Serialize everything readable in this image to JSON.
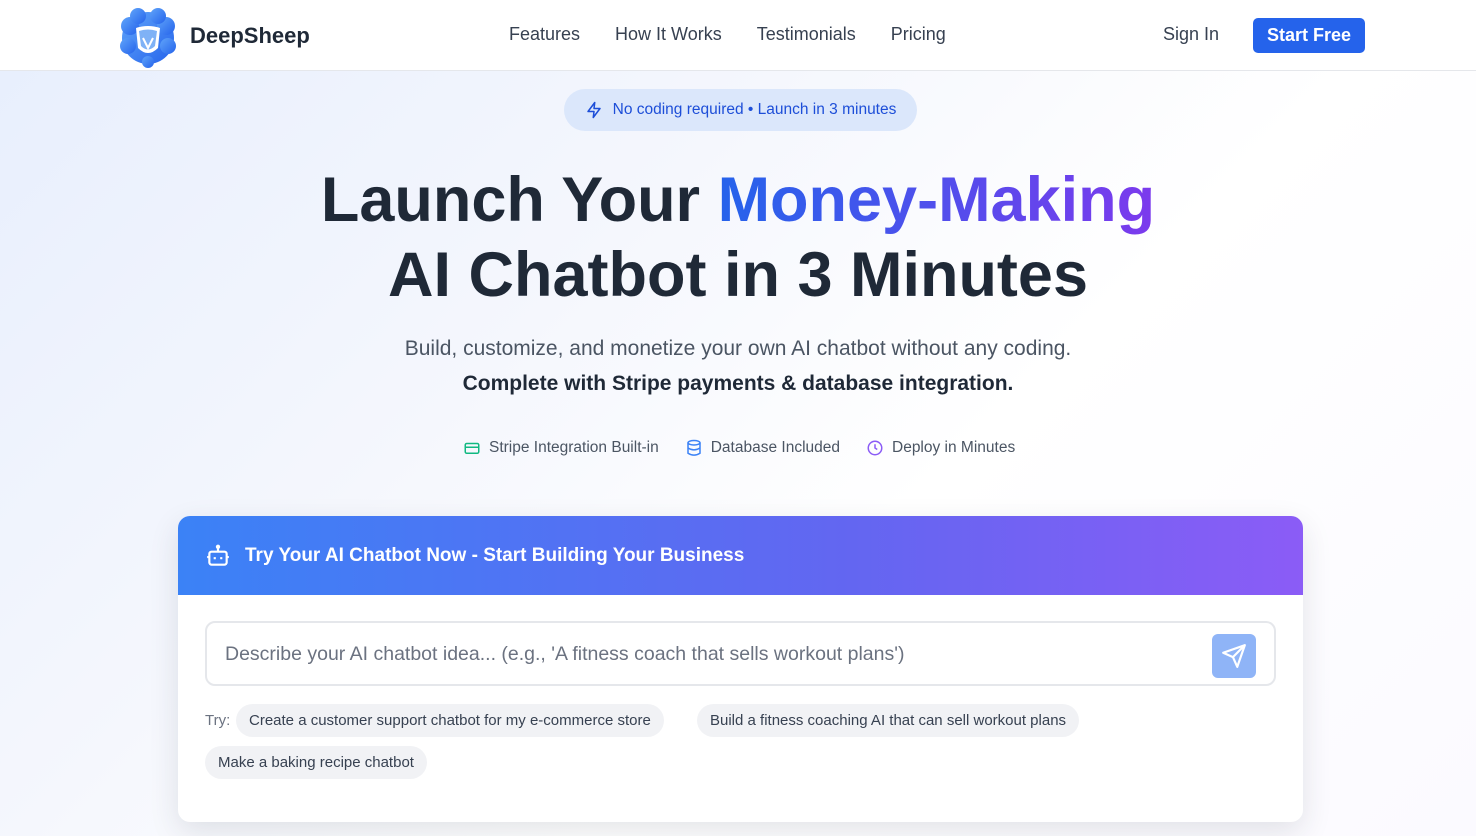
{
  "header": {
    "brand": "DeepSheep",
    "nav": [
      "Features",
      "How It Works",
      "Testimonials",
      "Pricing"
    ],
    "sign_in": "Sign In",
    "start_free": "Start Free"
  },
  "hero": {
    "badge": "No coding required • Launch in 3 minutes",
    "title_prefix": "Launch Your ",
    "title_highlight": "Money-Making",
    "title_line2": "AI Chatbot in 3 Minutes",
    "subtitle": "Build, customize, and monetize your own AI chatbot without any coding.",
    "subtitle_bold": "Complete with Stripe payments & database integration.",
    "features": [
      {
        "icon": "credit-card-icon",
        "label": "Stripe Integration Built-in",
        "color": "#10b981"
      },
      {
        "icon": "database-icon",
        "label": "Database Included",
        "color": "#3b82f6"
      },
      {
        "icon": "clock-icon",
        "label": "Deploy in Minutes",
        "color": "#8b5cf6"
      }
    ]
  },
  "card": {
    "title": "Try Your AI Chatbot Now - Start Building Your Business",
    "placeholder": "Describe your AI chatbot idea... (e.g., 'A fitness coach that sells workout plans')",
    "try_label": "Try:",
    "suggestions": [
      "Create a customer support chatbot for my e-commerce store",
      "Build a fitness coaching AI that can sell workout plans",
      "Make a baking recipe chatbot"
    ]
  },
  "colors": {
    "primary": "#2563eb",
    "accent": "#7c3aed"
  }
}
